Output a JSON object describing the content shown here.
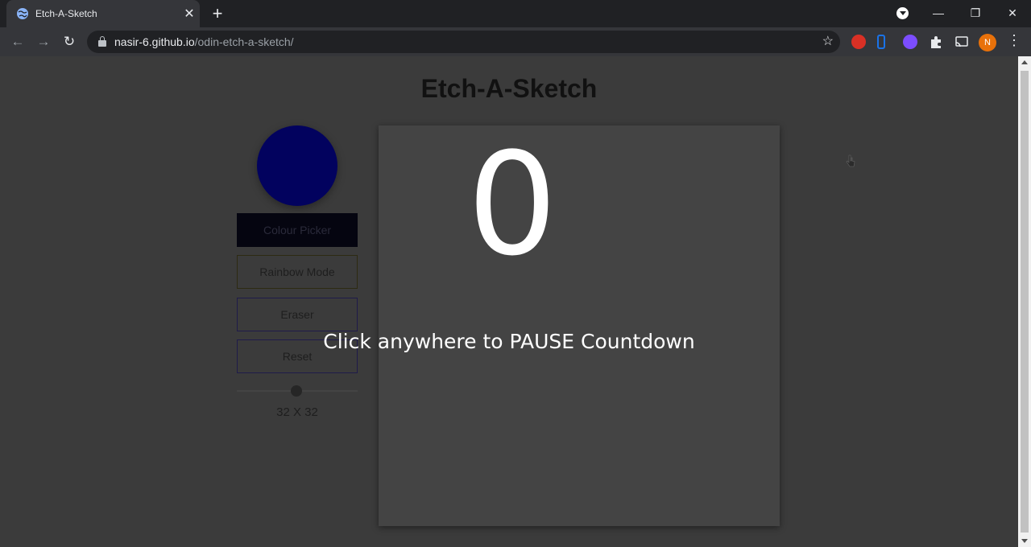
{
  "browser": {
    "tab_title": "Etch-A-Sketch",
    "new_tab": "+",
    "url_host": "nasir-6.github.io",
    "url_path": "/odin-etch-a-sketch/",
    "profile_initial": "N",
    "window_controls": {
      "minimize": "—",
      "restore": "❐",
      "close": "✕"
    },
    "tab_close": "✕",
    "nav": {
      "back": "←",
      "forward": "→",
      "reload": "↻"
    },
    "star": "☆",
    "menu": "⋮"
  },
  "page": {
    "title": "Etch-A-Sketch",
    "buttons": {
      "colour_picker": "Colour Picker",
      "rainbow_mode": "Rainbow Mode",
      "eraser": "Eraser",
      "reset": "Reset"
    },
    "grid_size_label": "32 X 32",
    "grid_size_value": 32,
    "selected_colour": "#02025e",
    "overlay": {
      "countdown": "0",
      "message": "Click anywhere to PAUSE Countdown"
    }
  },
  "icons": {
    "favicon": "globe-icon",
    "extensions": [
      "red-hand-extension-icon",
      "blue-k-extension-icon",
      "purple-flower-extension-icon",
      "puzzle-extensions-icon",
      "cast-icon"
    ]
  }
}
